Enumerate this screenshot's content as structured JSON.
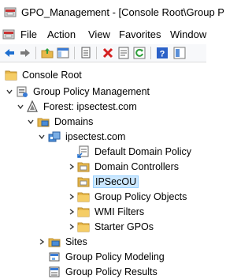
{
  "window": {
    "title": "GPO_Management - [Console Root\\Group P"
  },
  "menu": {
    "items": [
      "File",
      "Action",
      "View",
      "Favorites",
      "Window"
    ]
  },
  "toolbar": {
    "icons": [
      "back-arrow-icon",
      "forward-arrow-icon",
      "up-folder-icon",
      "show-hide-tree-icon",
      "copy-icon",
      "delete-icon",
      "properties-icon",
      "refresh-icon",
      "help-icon",
      "extra-icon"
    ]
  },
  "tree": {
    "console_root": "Console Root",
    "gpm": "Group Policy Management",
    "forest": "Forest: ipsectest.com",
    "domains": "Domains",
    "domain": "ipsectest.com",
    "default_policy": "Default Domain Policy",
    "domain_controllers": "Domain Controllers",
    "ipsecou": "IPSecOU",
    "gpo": "Group Policy Objects",
    "wmi": "WMI Filters",
    "starter": "Starter GPOs",
    "sites": "Sites",
    "modeling": "Group Policy Modeling",
    "results": "Group Policy Results"
  },
  "colors": {
    "selection_bg": "#cce8ff",
    "folder_yellow": "#e8b84a"
  }
}
